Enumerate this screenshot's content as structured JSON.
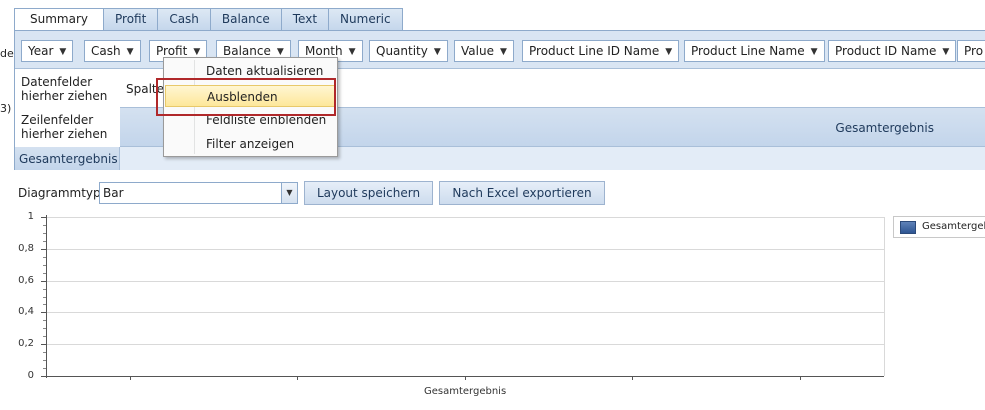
{
  "left_fragments": [
    "de",
    "3)"
  ],
  "tabs": [
    {
      "label": "Summary",
      "active": true
    },
    {
      "label": "Profit"
    },
    {
      "label": "Cash"
    },
    {
      "label": "Balance"
    },
    {
      "label": "Text"
    },
    {
      "label": "Numeric"
    }
  ],
  "filter_fields": [
    "Year",
    "Cash",
    "Profit",
    "Balance",
    "Month",
    "Quantity",
    "Value",
    "Product Line ID Name",
    "Product Line Name",
    "Product ID Name",
    "Pro"
  ],
  "pivot": {
    "data_area_label_1": "Datenfelder",
    "data_area_label_2": "hierher ziehen",
    "column_area_label": "Spalte",
    "row_area_label_1": "Zeilenfelder",
    "row_area_label_2": "hierher ziehen",
    "column_grand_total": "Gesamtergebnis",
    "row_grand_total": "Gesamtergebnis"
  },
  "context_menu": {
    "items": [
      "Daten aktualisieren",
      "Ausblenden",
      "Feldliste einblenden",
      "Filter anzeigen"
    ],
    "highlighted_index": 1
  },
  "toolbar": {
    "chart_type_label": "Diagrammtyp",
    "chart_type_value": "Bar",
    "save_layout_label": "Layout speichern",
    "export_excel_label": "Nach Excel exportieren"
  },
  "chart_data": {
    "type": "bar",
    "categories": [
      "Gesamtergebnis"
    ],
    "series": [
      {
        "name": "Gesamtergebnis",
        "values": []
      }
    ],
    "y_tick_labels": [
      "1",
      "0,8",
      "0,6",
      "0,4",
      "0,2",
      "0"
    ],
    "ylim": [
      0,
      1
    ],
    "grid": true,
    "legend_position": "right",
    "series_color": "#3f66a3"
  }
}
